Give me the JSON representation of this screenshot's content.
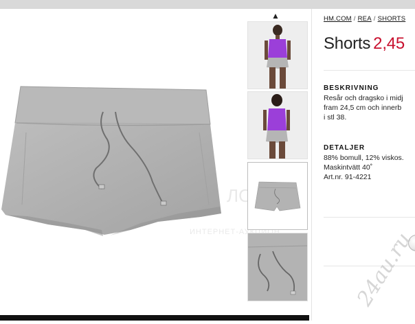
{
  "breadcrumb": {
    "items": [
      "HM.COM",
      "REA",
      "SHORTS"
    ],
    "separator": "/"
  },
  "product": {
    "name": "Shorts",
    "price": "2,45"
  },
  "description": {
    "heading": "BESKRIVNING",
    "lines": [
      "Resår och dragsko i midj",
      "fram 24,5 cm och innerb",
      "i stl 38."
    ]
  },
  "details": {
    "heading": "DETALJER",
    "lines": [
      "88% bomull, 12% viskos.",
      "Maskintvätt 40˚",
      "Art.nr. 91-4221"
    ]
  },
  "watermarks": {
    "site": "24au.ru",
    "faint": "ЛОТ",
    "faint_sub": "ИНТЕРНЕТ-АУКЦИОН"
  },
  "colors": {
    "price": "#c8102e",
    "shorts_gray": "#b3b3b3",
    "model_top": "#9b3fd9"
  },
  "icons": {
    "thumb_scroll_up": "chevron-up-icon"
  }
}
